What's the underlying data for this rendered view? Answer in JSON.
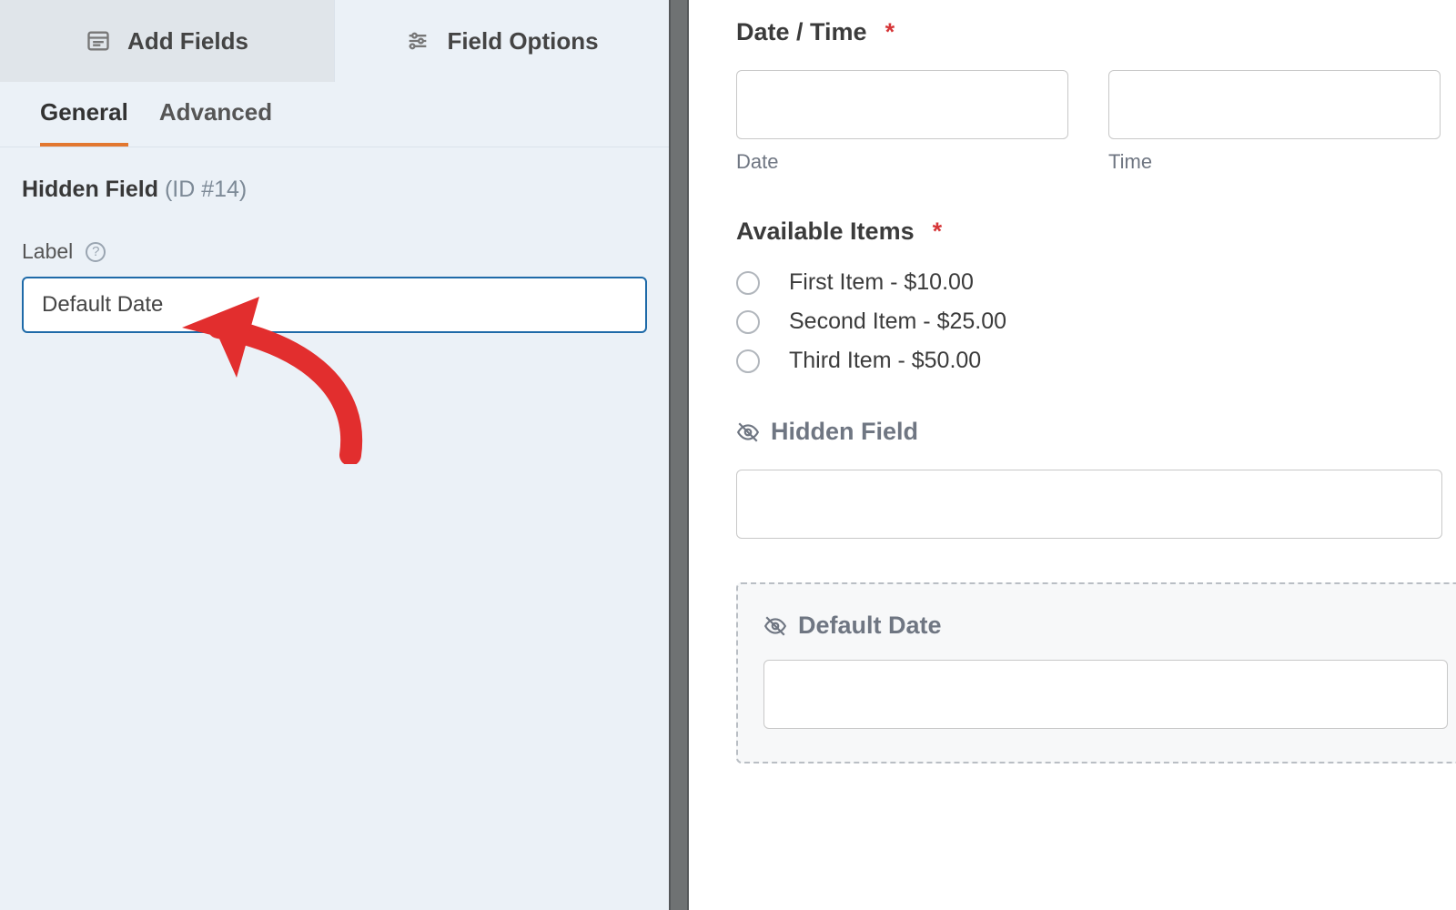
{
  "sidebar": {
    "top_tabs": {
      "add_fields": "Add Fields",
      "field_options": "Field Options"
    },
    "sub_tabs": {
      "general": "General",
      "advanced": "Advanced"
    },
    "section_title_name": "Hidden Field",
    "section_title_id": "(ID #14)",
    "label_caption": "Label",
    "label_value": "Default Date"
  },
  "preview": {
    "datetime": {
      "title": "Date / Time",
      "date_sub": "Date",
      "time_sub": "Time"
    },
    "available_items": {
      "title": "Available Items",
      "items": [
        "First Item - $10.00",
        "Second Item - $25.00",
        "Third Item - $50.00"
      ]
    },
    "hidden_field": {
      "title": "Hidden Field"
    },
    "default_date": {
      "title": "Default Date"
    }
  },
  "marks": {
    "required": "*"
  }
}
